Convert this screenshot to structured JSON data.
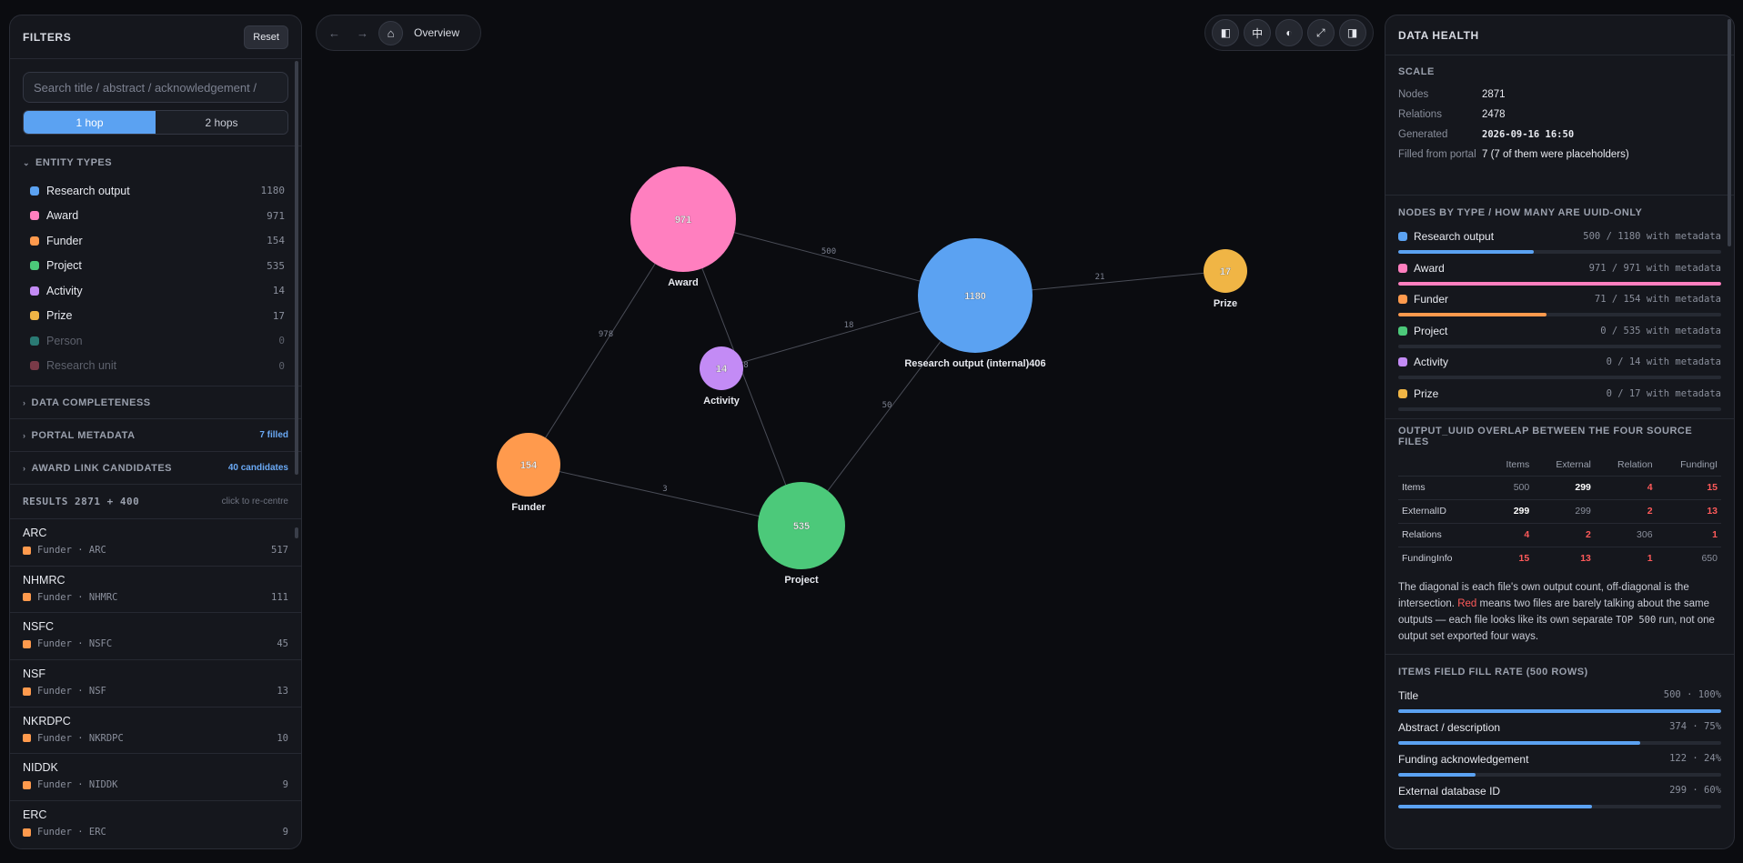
{
  "filters": {
    "title": "FILTERS",
    "reset_label": "Reset",
    "search_placeholder": "Search title / abstract / acknowledgement /",
    "hops": [
      "1 hop",
      "2 hops"
    ],
    "entity_types_title": "ENTITY TYPES",
    "entity_types": [
      {
        "label": "Research output",
        "count": "1180",
        "color": "#5ba2f2",
        "dim": false
      },
      {
        "label": "Award",
        "count": "971",
        "color": "#ff7fbf",
        "dim": false
      },
      {
        "label": "Funder",
        "count": "154",
        "color": "#ff9a4d",
        "dim": false
      },
      {
        "label": "Project",
        "count": "535",
        "color": "#4cc97a",
        "dim": false
      },
      {
        "label": "Activity",
        "count": "14",
        "color": "#c38bf5",
        "dim": false
      },
      {
        "label": "Prize",
        "count": "17",
        "color": "#f0b545",
        "dim": false
      },
      {
        "label": "Person",
        "count": "0",
        "color": "#2a7a74",
        "dim": true
      },
      {
        "label": "Research unit",
        "count": "0",
        "color": "#7a3a48",
        "dim": true
      }
    ],
    "collapsed_sections": [
      {
        "label": "DATA COMPLETENESS",
        "badge": ""
      },
      {
        "label": "PORTAL METADATA",
        "badge": "7 filled"
      },
      {
        "label": "AWARD LINK CANDIDATES",
        "badge": "40 candidates"
      }
    ],
    "results_title": "RESULTS 2871 + 400",
    "results_hint": "click to re-centre",
    "results": [
      {
        "name": "ARC",
        "meta": "Funder · ARC",
        "count": "517"
      },
      {
        "name": "NHMRC",
        "meta": "Funder · NHMRC",
        "count": "111"
      },
      {
        "name": "NSFC",
        "meta": "Funder · NSFC",
        "count": "45"
      },
      {
        "name": "NSF",
        "meta": "Funder · NSF",
        "count": "13"
      },
      {
        "name": "NKRDPC",
        "meta": "Funder · NKRDPC",
        "count": "10"
      },
      {
        "name": "NIDDK",
        "meta": "Funder · NIDDK",
        "count": "9"
      },
      {
        "name": "ERC",
        "meta": "Funder · ERC",
        "count": "9"
      }
    ]
  },
  "nav": {
    "back_icon": "←",
    "forward_icon": "→",
    "home_icon": "⌂",
    "label": "Overview"
  },
  "toolbar": {
    "buttons": [
      "◧",
      "中",
      "◐",
      "⤢",
      "◨"
    ]
  },
  "graph": {
    "nodes": [
      {
        "id": "award",
        "value": "971",
        "label": "Award",
        "color": "#ff7fbf"
      },
      {
        "id": "research",
        "value": "1180",
        "label": "Research output (internal)406",
        "color": "#5ba2f2"
      },
      {
        "id": "prize",
        "value": "17",
        "label": "Prize",
        "color": "#f0b545"
      },
      {
        "id": "activity",
        "value": "14",
        "label": "Activity",
        "color": "#c38bf5"
      },
      {
        "id": "funder",
        "value": "154",
        "label": "Funder",
        "color": "#ff9a4d"
      },
      {
        "id": "project",
        "value": "535",
        "label": "Project",
        "color": "#4cc97a"
      }
    ],
    "edges": [
      {
        "from": "award",
        "to": "research",
        "label": "500"
      },
      {
        "from": "research",
        "to": "prize",
        "label": "21"
      },
      {
        "from": "award",
        "to": "funder",
        "label": "978"
      },
      {
        "from": "activity",
        "to": "research",
        "label": "18"
      },
      {
        "from": "award",
        "to": "project",
        "label": "8"
      },
      {
        "from": "research",
        "to": "project",
        "label": "50"
      },
      {
        "from": "funder",
        "to": "project",
        "label": "3"
      }
    ]
  },
  "health": {
    "title": "DATA HEALTH",
    "scale_title": "SCALE",
    "scale": [
      {
        "k": "Nodes",
        "v": "2871"
      },
      {
        "k": "Relations",
        "v": "2478"
      },
      {
        "k": "Generated",
        "v": "2026-09-16 16:50"
      },
      {
        "k": "Filled from portal",
        "v": "7 (7 of them were placeholders)"
      }
    ],
    "types_title": "NODES BY TYPE / HOW MANY ARE UUID-ONLY",
    "types": [
      {
        "label": "Research output",
        "stat": "500 / 1180 with metadata",
        "fraction": 0.42,
        "color": "#5ba2f2"
      },
      {
        "label": "Award",
        "stat": "971 / 971 with metadata",
        "fraction": 1.0,
        "color": "#ff7fbf"
      },
      {
        "label": "Funder",
        "stat": "71 / 154 with metadata",
        "fraction": 0.46,
        "color": "#ff9a4d"
      },
      {
        "label": "Project",
        "stat": "0 / 535 with metadata",
        "fraction": 0,
        "color": "#4cc97a"
      },
      {
        "label": "Activity",
        "stat": "0 / 14 with metadata",
        "fraction": 0,
        "color": "#c38bf5"
      },
      {
        "label": "Prize",
        "stat": "0 / 17 with metadata",
        "fraction": 0,
        "color": "#f0b545"
      }
    ],
    "overlap_title": "OUTPUT_UUID OVERLAP BETWEEN THE FOUR SOURCE FILES",
    "overlap_cols": [
      "Items",
      "External",
      "Relation",
      "FundingI"
    ],
    "overlap_rows": [
      {
        "label": "Items",
        "cells": [
          "500",
          "299",
          "4",
          "15"
        ],
        "styles": [
          "",
          "hi",
          "red",
          "red"
        ]
      },
      {
        "label": "ExternalID",
        "cells": [
          "299",
          "299",
          "2",
          "13"
        ],
        "styles": [
          "hi",
          "",
          "red",
          "red"
        ]
      },
      {
        "label": "Relations",
        "cells": [
          "4",
          "2",
          "306",
          "1"
        ],
        "styles": [
          "red",
          "red",
          "",
          "red"
        ]
      },
      {
        "label": "FundingInfo",
        "cells": [
          "15",
          "13",
          "1",
          "650"
        ],
        "styles": [
          "red",
          "red",
          "red",
          ""
        ]
      }
    ],
    "overlap_note_1": "The diagonal is each file's own output count, off-diagonal is the intersection. ",
    "overlap_note_red": "Red",
    "overlap_note_2": " means two files are barely talking about the same outputs — each file looks like its own separate ",
    "overlap_note_code": "TOP 500",
    "overlap_note_3": " run, not one output set exported four ways.",
    "fill_title": "ITEMS FIELD FILL RATE (500 ROWS)",
    "fill_rates": [
      {
        "label": "Title",
        "stat": "500 · 100%",
        "fraction": 1.0
      },
      {
        "label": "Abstract / description",
        "stat": "374 · 75%",
        "fraction": 0.75
      },
      {
        "label": "Funding acknowledgement",
        "stat": "122 · 24%",
        "fraction": 0.24
      },
      {
        "label": "External database ID",
        "stat": "299 · 60%",
        "fraction": 0.6
      }
    ]
  }
}
